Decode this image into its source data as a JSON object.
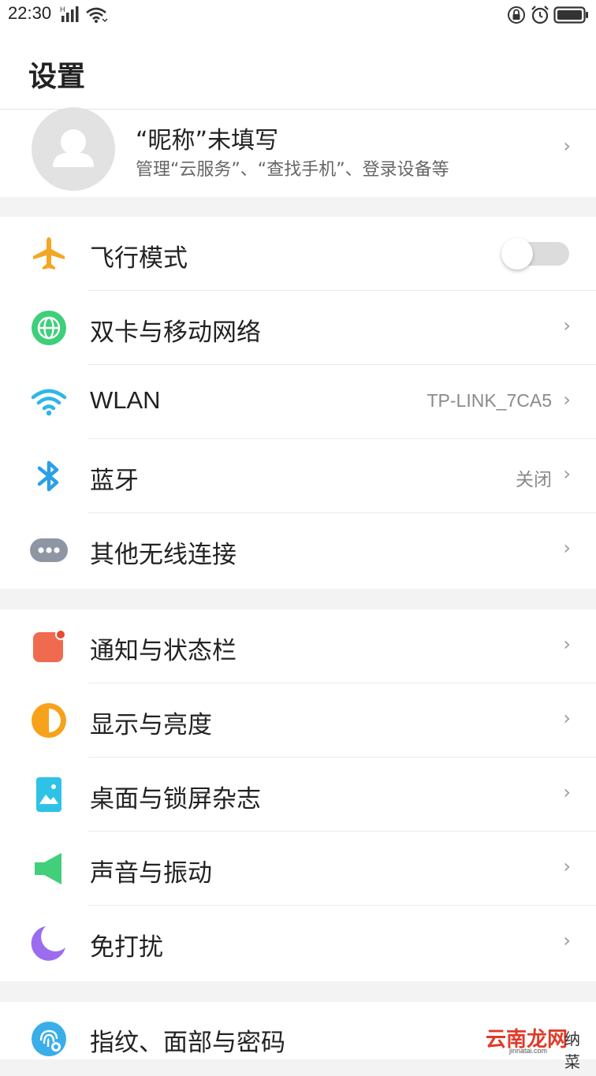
{
  "status_bar": {
    "time": "22:30",
    "network_label": "H",
    "icons": [
      "signal-icon",
      "wifi-icon",
      "lock-rotation-icon",
      "alarm-icon",
      "battery-icon"
    ]
  },
  "header": {
    "title": "设置"
  },
  "profile": {
    "name": "“昵称”未填写",
    "subtitle": "管理“云服务”、“查找手机”、登录设备等"
  },
  "sections": [
    {
      "items": [
        {
          "label": "飞行模式",
          "icon": "airplane-icon",
          "toggle_on": false
        },
        {
          "label": "双卡与移动网络",
          "icon": "globe-icon"
        },
        {
          "label": "WLAN",
          "icon": "wifi-icon",
          "value": "TP-LINK_7CA5"
        },
        {
          "label": "蓝牙",
          "icon": "bluetooth-icon",
          "value": "关闭"
        },
        {
          "label": "其他无线连接",
          "icon": "more-dots-icon"
        }
      ]
    },
    {
      "items": [
        {
          "label": "通知与状态栏",
          "icon": "notification-icon"
        },
        {
          "label": "显示与亮度",
          "icon": "brightness-icon"
        },
        {
          "label": "桌面与锁屏杂志",
          "icon": "wallpaper-icon"
        },
        {
          "label": "声音与振动",
          "icon": "sound-icon"
        },
        {
          "label": "免打扰",
          "icon": "moon-icon"
        }
      ]
    },
    {
      "items": [
        {
          "label": "指纹、面部与密码",
          "icon": "fingerprint-icon"
        }
      ]
    }
  ],
  "colors": {
    "airplane": "#f5a623",
    "globe": "#3fcf7a",
    "wifi": "#2fb6e8",
    "bluetooth": "#2b9fe8",
    "more": "#8e96a3",
    "notification": "#f06a50",
    "brightness": "#f7a21b",
    "wallpaper": "#2ec3e6",
    "sound": "#41cf7b",
    "moon": "#9b6cf0",
    "fingerprint": "#3aaee8"
  },
  "watermark": {
    "text": "云南龙网",
    "side": "纳菜",
    "url": "jinnatai.com"
  }
}
